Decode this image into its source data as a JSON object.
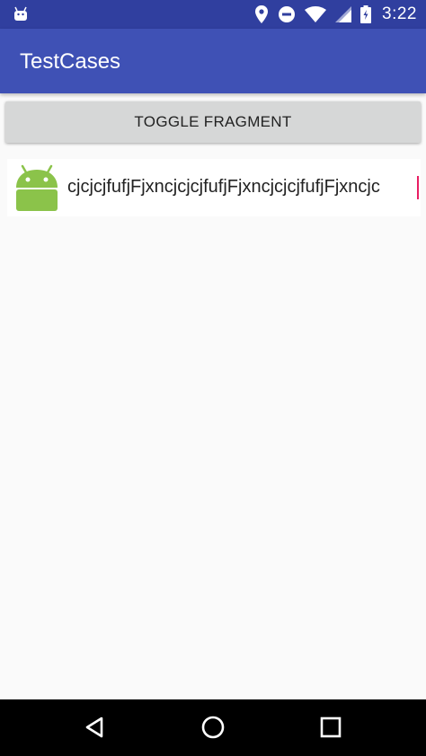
{
  "status_bar": {
    "time": "3:22",
    "left_icon": "android-notification-icon",
    "icons": [
      "location-icon",
      "do-not-disturb-icon",
      "wifi-icon",
      "signal-icon",
      "battery-icon"
    ]
  },
  "app_bar": {
    "title": "TestCases",
    "color": "#3f51b5",
    "status_color": "#303f9f"
  },
  "toggle_button": {
    "label": "TOGGLE FRAGMENT"
  },
  "list": {
    "items": [
      {
        "icon": "android-robot-icon",
        "text": "cjcjcjfufjFjxncjcjcjfufjFjxncjcjcjfufjFjxncjc"
      }
    ]
  },
  "nav_bar": {
    "buttons": [
      "back-icon",
      "home-icon",
      "recents-icon"
    ]
  },
  "colors": {
    "accent": "#e91e63",
    "android_green": "#8bc34a"
  }
}
